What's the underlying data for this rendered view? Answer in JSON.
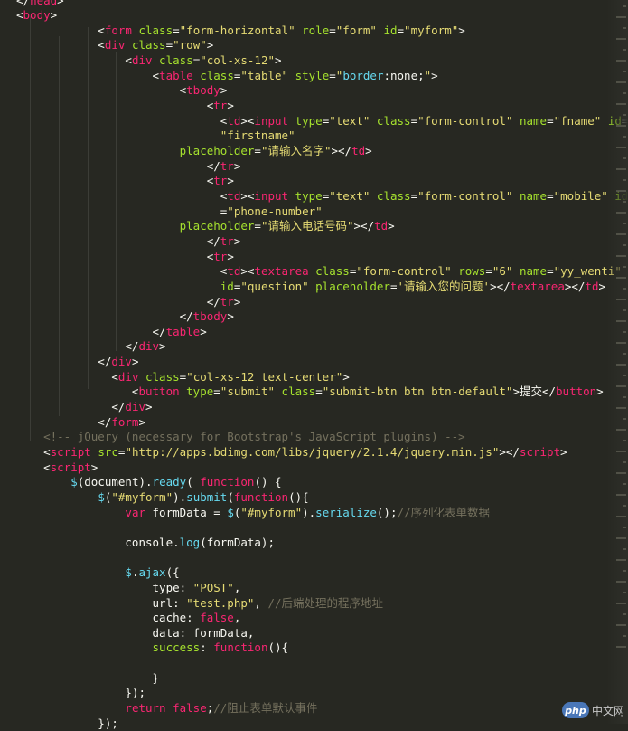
{
  "editor": {
    "theme_colors": {
      "background": "#272822",
      "tag": "#f92672",
      "attribute": "#a6e22e",
      "string": "#e6db74",
      "comment": "#75715e",
      "function": "#66d9ef"
    },
    "lines": [
      [
        [
          "c-plain",
          "</"
        ],
        [
          "c-tag",
          "head"
        ],
        [
          "c-plain",
          ">"
        ]
      ],
      [
        [
          "c-plain",
          "<"
        ],
        [
          "c-tag",
          "body"
        ],
        [
          "c-plain",
          ">"
        ]
      ],
      [
        [
          "c-plain",
          "            <"
        ],
        [
          "c-tag",
          "form"
        ],
        [
          "c-plain",
          " "
        ],
        [
          "c-attr",
          "class"
        ],
        [
          "c-plain",
          "="
        ],
        [
          "c-str",
          "\"form-horizontal\""
        ],
        [
          "c-plain",
          " "
        ],
        [
          "c-attr",
          "role"
        ],
        [
          "c-plain",
          "="
        ],
        [
          "c-str",
          "\"form\""
        ],
        [
          "c-plain",
          " "
        ],
        [
          "c-attr",
          "id"
        ],
        [
          "c-plain",
          "="
        ],
        [
          "c-str",
          "\"myform\""
        ],
        [
          "c-plain",
          ">"
        ]
      ],
      [
        [
          "c-plain",
          "            <"
        ],
        [
          "c-tag",
          "div"
        ],
        [
          "c-plain",
          " "
        ],
        [
          "c-attr",
          "class"
        ],
        [
          "c-plain",
          "="
        ],
        [
          "c-str",
          "\"row\""
        ],
        [
          "c-plain",
          ">"
        ]
      ],
      [
        [
          "c-plain",
          "                <"
        ],
        [
          "c-tag",
          "div"
        ],
        [
          "c-plain",
          " "
        ],
        [
          "c-attr",
          "class"
        ],
        [
          "c-plain",
          "="
        ],
        [
          "c-str",
          "\"col-xs-12\""
        ],
        [
          "c-plain",
          ">"
        ]
      ],
      [
        [
          "c-plain",
          "                    <"
        ],
        [
          "c-tag",
          "table"
        ],
        [
          "c-plain",
          " "
        ],
        [
          "c-attr",
          "class"
        ],
        [
          "c-plain",
          "="
        ],
        [
          "c-str",
          "\"table\""
        ],
        [
          "c-plain",
          " "
        ],
        [
          "c-attr",
          "style"
        ],
        [
          "c-plain",
          "="
        ],
        [
          "c-str",
          "\""
        ],
        [
          "c-fn",
          "border"
        ],
        [
          "c-plain",
          ":"
        ],
        [
          "c-plain",
          "none;"
        ],
        [
          "c-str",
          "\""
        ],
        [
          "c-plain",
          ">"
        ]
      ],
      [
        [
          "c-plain",
          "                        <"
        ],
        [
          "c-tag",
          "tbody"
        ],
        [
          "c-plain",
          ">"
        ]
      ],
      [
        [
          "c-plain",
          "                            <"
        ],
        [
          "c-tag",
          "tr"
        ],
        [
          "c-plain",
          ">"
        ]
      ],
      [
        [
          "c-plain",
          "                              <"
        ],
        [
          "c-tag",
          "td"
        ],
        [
          "c-plain",
          "><"
        ],
        [
          "c-tag",
          "input"
        ],
        [
          "c-plain",
          " "
        ],
        [
          "c-attr",
          "type"
        ],
        [
          "c-plain",
          "="
        ],
        [
          "c-str",
          "\"text\""
        ],
        [
          "c-plain",
          " "
        ],
        [
          "c-attr",
          "class"
        ],
        [
          "c-plain",
          "="
        ],
        [
          "c-str",
          "\"form-control\""
        ],
        [
          "c-plain",
          " "
        ],
        [
          "c-attr",
          "name"
        ],
        [
          "c-plain",
          "="
        ],
        [
          "c-str",
          "\"fname\""
        ],
        [
          "c-plain",
          " "
        ],
        [
          "c-attr",
          "id"
        ],
        [
          "c-plain",
          "="
        ]
      ],
      [
        [
          "c-plain",
          "                              "
        ],
        [
          "c-str",
          "\"firstname\""
        ]
      ],
      [
        [
          "c-plain",
          "                        "
        ],
        [
          "c-attr",
          "placeholder"
        ],
        [
          "c-plain",
          "="
        ],
        [
          "c-str",
          "\"请输入名字\""
        ],
        [
          "c-plain",
          "></"
        ],
        [
          "c-tag",
          "td"
        ],
        [
          "c-plain",
          ">"
        ]
      ],
      [
        [
          "c-plain",
          "                            </"
        ],
        [
          "c-tag",
          "tr"
        ],
        [
          "c-plain",
          ">"
        ]
      ],
      [
        [
          "c-plain",
          "                            <"
        ],
        [
          "c-tag",
          "tr"
        ],
        [
          "c-plain",
          ">"
        ]
      ],
      [
        [
          "c-plain",
          "                              <"
        ],
        [
          "c-tag",
          "td"
        ],
        [
          "c-plain",
          "><"
        ],
        [
          "c-tag",
          "input"
        ],
        [
          "c-plain",
          " "
        ],
        [
          "c-attr",
          "type"
        ],
        [
          "c-plain",
          "="
        ],
        [
          "c-str",
          "\"text\""
        ],
        [
          "c-plain",
          " "
        ],
        [
          "c-attr",
          "class"
        ],
        [
          "c-plain",
          "="
        ],
        [
          "c-str",
          "\"form-control\""
        ],
        [
          "c-plain",
          " "
        ],
        [
          "c-attr",
          "name"
        ],
        [
          "c-plain",
          "="
        ],
        [
          "c-str",
          "\"mobile\""
        ],
        [
          "c-plain",
          " "
        ],
        [
          "c-attr",
          "id"
        ]
      ],
      [
        [
          "c-plain",
          "                              ="
        ],
        [
          "c-str",
          "\"phone-number\""
        ]
      ],
      [
        [
          "c-plain",
          "                        "
        ],
        [
          "c-attr",
          "placeholder"
        ],
        [
          "c-plain",
          "="
        ],
        [
          "c-str",
          "\"请输入电话号码\""
        ],
        [
          "c-plain",
          "></"
        ],
        [
          "c-tag",
          "td"
        ],
        [
          "c-plain",
          ">"
        ]
      ],
      [
        [
          "c-plain",
          "                            </"
        ],
        [
          "c-tag",
          "tr"
        ],
        [
          "c-plain",
          ">"
        ]
      ],
      [
        [
          "c-plain",
          "                            <"
        ],
        [
          "c-tag",
          "tr"
        ],
        [
          "c-plain",
          ">"
        ]
      ],
      [
        [
          "c-plain",
          "                              <"
        ],
        [
          "c-tag",
          "td"
        ],
        [
          "c-plain",
          "><"
        ],
        [
          "c-tag",
          "textarea"
        ],
        [
          "c-plain",
          " "
        ],
        [
          "c-attr",
          "class"
        ],
        [
          "c-plain",
          "="
        ],
        [
          "c-str",
          "\"form-control\""
        ],
        [
          "c-plain",
          " "
        ],
        [
          "c-attr",
          "rows"
        ],
        [
          "c-plain",
          "="
        ],
        [
          "c-str",
          "\"6\""
        ],
        [
          "c-plain",
          " "
        ],
        [
          "c-attr",
          "name"
        ],
        [
          "c-plain",
          "="
        ],
        [
          "c-str",
          "\"yy_wenti\""
        ]
      ],
      [
        [
          "c-plain",
          "                              "
        ],
        [
          "c-attr",
          "id"
        ],
        [
          "c-plain",
          "="
        ],
        [
          "c-str",
          "\"question\""
        ],
        [
          "c-plain",
          " "
        ],
        [
          "c-attr",
          "placeholder"
        ],
        [
          "c-plain",
          "="
        ],
        [
          "c-str",
          "'请输入您的问题'"
        ],
        [
          "c-plain",
          "></"
        ],
        [
          "c-tag",
          "textarea"
        ],
        [
          "c-plain",
          "></"
        ],
        [
          "c-tag",
          "td"
        ],
        [
          "c-plain",
          ">"
        ]
      ],
      [
        [
          "c-plain",
          "                            </"
        ],
        [
          "c-tag",
          "tr"
        ],
        [
          "c-plain",
          ">"
        ]
      ],
      [
        [
          "c-plain",
          "                        </"
        ],
        [
          "c-tag",
          "tbody"
        ],
        [
          "c-plain",
          ">"
        ]
      ],
      [
        [
          "c-plain",
          "                    </"
        ],
        [
          "c-tag",
          "table"
        ],
        [
          "c-plain",
          ">"
        ]
      ],
      [
        [
          "c-plain",
          "                </"
        ],
        [
          "c-tag",
          "div"
        ],
        [
          "c-plain",
          ">"
        ]
      ],
      [
        [
          "c-plain",
          "            </"
        ],
        [
          "c-tag",
          "div"
        ],
        [
          "c-plain",
          ">"
        ]
      ],
      [
        [
          "c-plain",
          "              <"
        ],
        [
          "c-tag",
          "div"
        ],
        [
          "c-plain",
          " "
        ],
        [
          "c-attr",
          "class"
        ],
        [
          "c-plain",
          "="
        ],
        [
          "c-str",
          "\"col-xs-12 text-center\""
        ],
        [
          "c-plain",
          ">"
        ]
      ],
      [
        [
          "c-plain",
          "                 <"
        ],
        [
          "c-tag",
          "button"
        ],
        [
          "c-plain",
          " "
        ],
        [
          "c-attr",
          "type"
        ],
        [
          "c-plain",
          "="
        ],
        [
          "c-str",
          "\"submit\""
        ],
        [
          "c-plain",
          " "
        ],
        [
          "c-attr",
          "class"
        ],
        [
          "c-plain",
          "="
        ],
        [
          "c-str",
          "\"submit-btn btn btn-default\""
        ],
        [
          "c-plain",
          ">提交</"
        ],
        [
          "c-tag",
          "button"
        ],
        [
          "c-plain",
          ">"
        ]
      ],
      [
        [
          "c-plain",
          "              </"
        ],
        [
          "c-tag",
          "div"
        ],
        [
          "c-plain",
          ">"
        ]
      ],
      [
        [
          "c-plain",
          "            </"
        ],
        [
          "c-tag",
          "form"
        ],
        [
          "c-plain",
          ">"
        ]
      ],
      [
        [
          "c-comment",
          "    <!-- jQuery (necessary for Bootstrap's JavaScript plugins) -->"
        ]
      ],
      [
        [
          "c-plain",
          "    <"
        ],
        [
          "c-tag",
          "script"
        ],
        [
          "c-plain",
          " "
        ],
        [
          "c-attr",
          "src"
        ],
        [
          "c-plain",
          "="
        ],
        [
          "c-str",
          "\"http://apps.bdimg.com/libs/jquery/2.1.4/jquery.min.js\""
        ],
        [
          "c-plain",
          "></"
        ],
        [
          "c-tag",
          "script"
        ],
        [
          "c-plain",
          ">"
        ]
      ],
      [
        [
          "c-plain",
          "    <"
        ],
        [
          "c-tag",
          "script"
        ],
        [
          "c-plain",
          ">"
        ]
      ],
      [
        [
          "c-plain",
          "        "
        ],
        [
          "c-fn",
          "$"
        ],
        [
          "c-plain",
          "(document)."
        ],
        [
          "c-fn",
          "ready"
        ],
        [
          "c-plain",
          "( "
        ],
        [
          "c-kw",
          "function"
        ],
        [
          "c-plain",
          "() {"
        ]
      ],
      [
        [
          "c-plain",
          "            "
        ],
        [
          "c-fn",
          "$"
        ],
        [
          "c-plain",
          "("
        ],
        [
          "c-str",
          "\"#myform\""
        ],
        [
          "c-plain",
          ")."
        ],
        [
          "c-fn",
          "submit"
        ],
        [
          "c-plain",
          "("
        ],
        [
          "c-kw",
          "function"
        ],
        [
          "c-plain",
          "(){"
        ]
      ],
      [
        [
          "c-plain",
          "                "
        ],
        [
          "c-kw",
          "var"
        ],
        [
          "c-plain",
          " formData = "
        ],
        [
          "c-fn",
          "$"
        ],
        [
          "c-plain",
          "("
        ],
        [
          "c-str",
          "\"#myform\""
        ],
        [
          "c-plain",
          ")."
        ],
        [
          "c-fn",
          "serialize"
        ],
        [
          "c-plain",
          "();"
        ],
        [
          "c-comment",
          "//序列化表单数据"
        ]
      ],
      [
        [
          "c-plain",
          ""
        ]
      ],
      [
        [
          "c-plain",
          "                console."
        ],
        [
          "c-fn",
          "log"
        ],
        [
          "c-plain",
          "(formData);"
        ]
      ],
      [
        [
          "c-plain",
          ""
        ]
      ],
      [
        [
          "c-plain",
          "                "
        ],
        [
          "c-fn",
          "$"
        ],
        [
          "c-plain",
          "."
        ],
        [
          "c-fn",
          "ajax"
        ],
        [
          "c-plain",
          "({"
        ]
      ],
      [
        [
          "c-plain",
          "                    type: "
        ],
        [
          "c-str",
          "\"POST\""
        ],
        [
          "c-plain",
          ","
        ]
      ],
      [
        [
          "c-plain",
          "                    url: "
        ],
        [
          "c-str",
          "\"test.php\""
        ],
        [
          "c-plain",
          ", "
        ],
        [
          "c-comment",
          "//后端处理的程序地址"
        ]
      ],
      [
        [
          "c-plain",
          "                    cache: "
        ],
        [
          "c-kw",
          "false"
        ],
        [
          "c-plain",
          ","
        ]
      ],
      [
        [
          "c-plain",
          "                    data: formData,"
        ]
      ],
      [
        [
          "c-plain",
          "                    "
        ],
        [
          "c-attr",
          "success"
        ],
        [
          "c-plain",
          ": "
        ],
        [
          "c-kw",
          "function"
        ],
        [
          "c-plain",
          "(){"
        ]
      ],
      [
        [
          "c-plain",
          ""
        ]
      ],
      [
        [
          "c-plain",
          "                    }"
        ]
      ],
      [
        [
          "c-plain",
          "                });"
        ]
      ],
      [
        [
          "c-plain",
          "                "
        ],
        [
          "c-kw",
          "return"
        ],
        [
          "c-plain",
          " "
        ],
        [
          "c-kw",
          "false"
        ],
        [
          "c-plain",
          ";"
        ],
        [
          "c-comment",
          "//阻止表单默认事件"
        ]
      ],
      [
        [
          "c-plain",
          "            });"
        ]
      ]
    ]
  },
  "watermark": {
    "logo": "php",
    "text": "中文网"
  }
}
